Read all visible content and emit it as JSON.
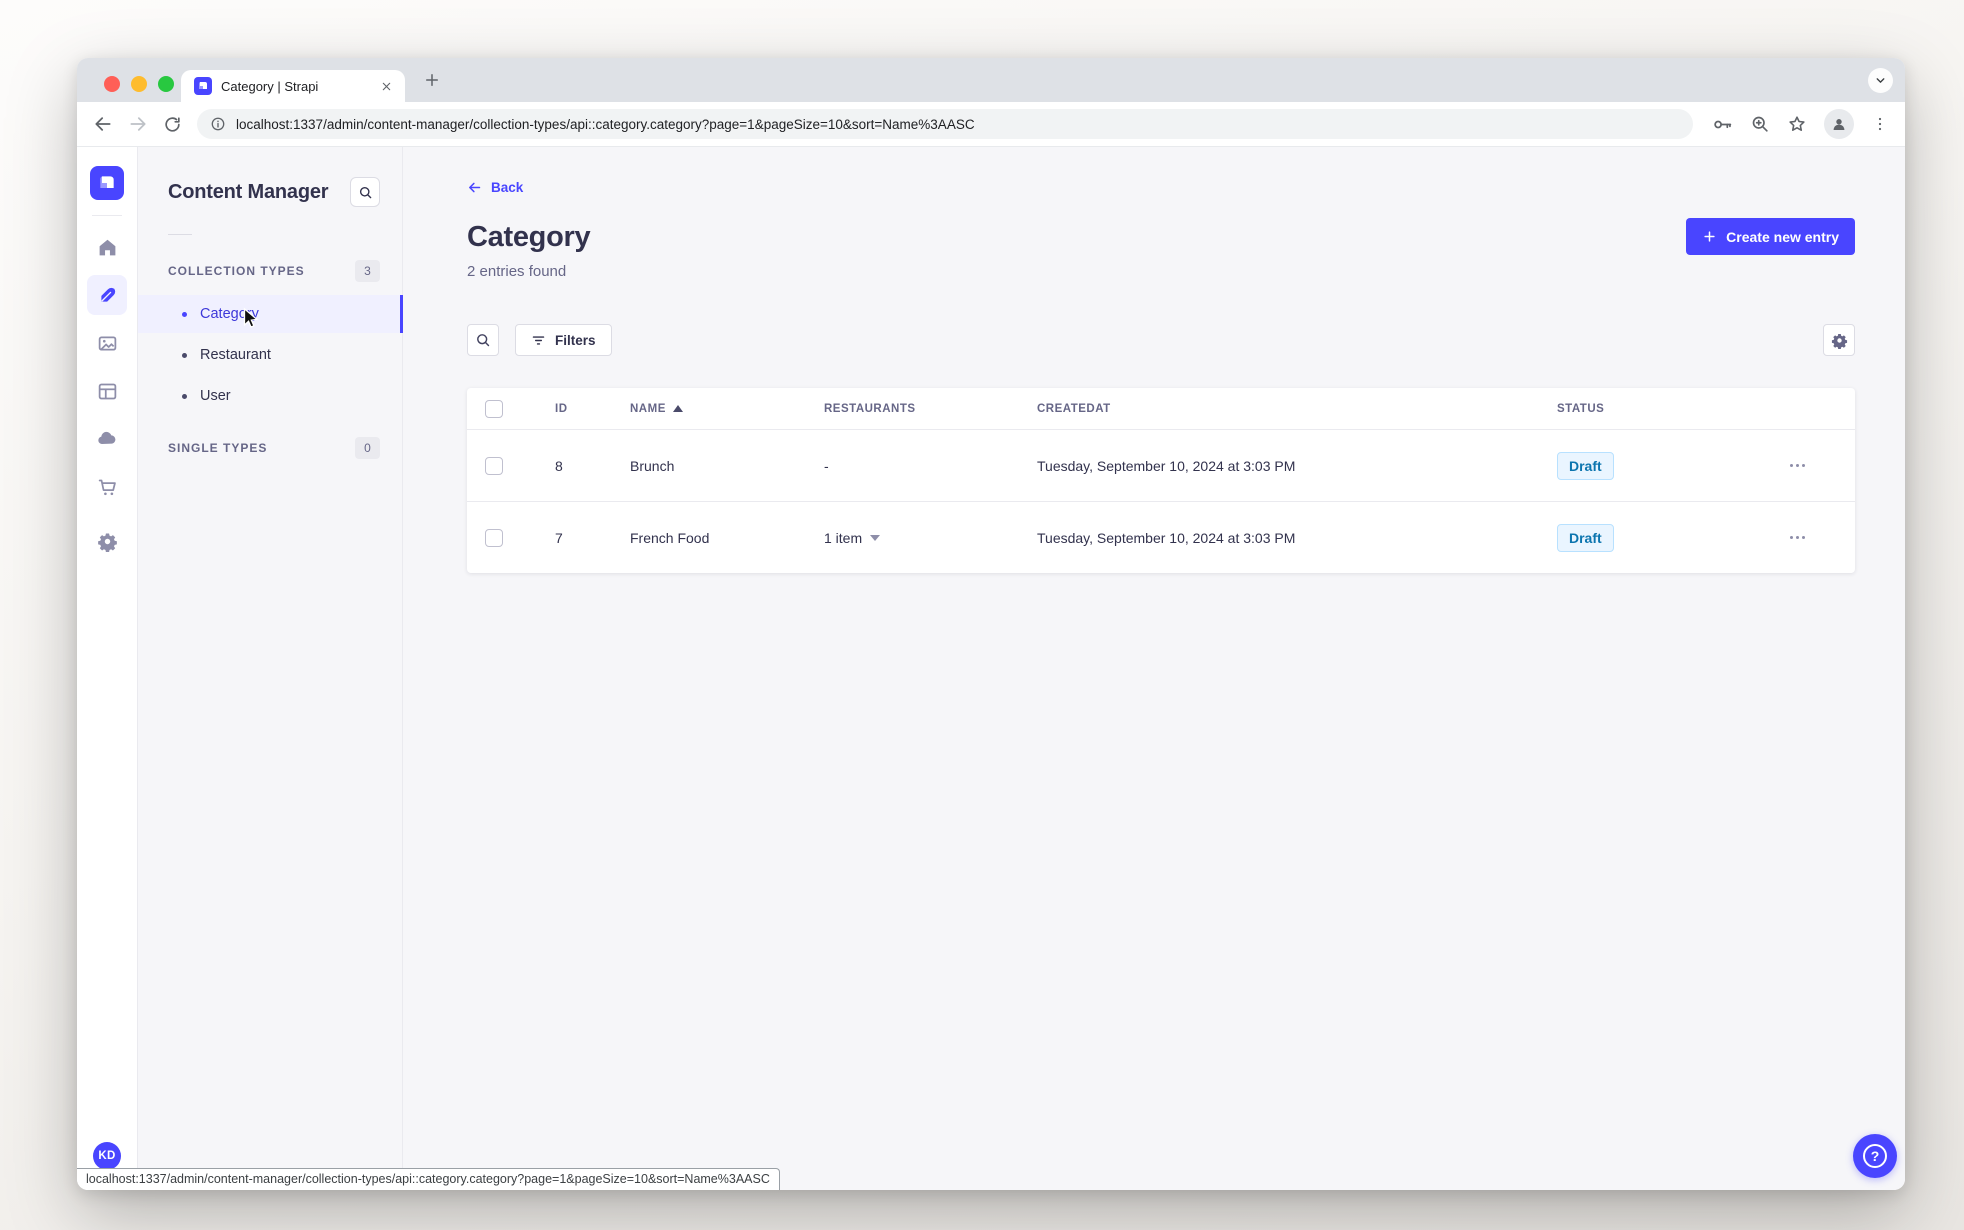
{
  "colors": {
    "primary": "#4945ff",
    "primary_bg": "#f0f0ff",
    "text_dark": "#32324d",
    "text_gray": "#666687",
    "border": "#eaeaef",
    "draft_bg": "#eaf5ff",
    "draft_border": "#b8e1ff",
    "draft_text": "#0c75af"
  },
  "browser": {
    "tab_title": "Category | Strapi",
    "url": "localhost:1337/admin/content-manager/collection-types/api::category.category?page=1&pageSize=10&sort=Name%3AASC",
    "status_url": "localhost:1337/admin/content-manager/collection-types/api::category.category?page=1&pageSize=10&sort=Name%3AASC"
  },
  "rail": {
    "avatar": "KD"
  },
  "subnav": {
    "title": "Content Manager",
    "collection_types": {
      "label": "COLLECTION TYPES",
      "count": "3"
    },
    "items": [
      {
        "label": "Category"
      },
      {
        "label": "Restaurant"
      },
      {
        "label": "User"
      }
    ],
    "single_types": {
      "label": "SINGLE TYPES",
      "count": "0"
    }
  },
  "page": {
    "back": "Back",
    "title": "Category",
    "subtitle": "2 entries found",
    "create_button": "Create new entry",
    "filters_button": "Filters"
  },
  "table": {
    "headers": {
      "id": "ID",
      "name": "NAME",
      "restaurants": "RESTAURANTS",
      "createdat": "CREATEDAT",
      "status": "STATUS"
    },
    "rows": [
      {
        "id": "8",
        "name": "Brunch",
        "restaurants": "-",
        "createdat": "Tuesday, September 10, 2024 at 3:03 PM",
        "status": "Draft"
      },
      {
        "id": "7",
        "name": "French Food",
        "restaurants": "1 item",
        "createdat": "Tuesday, September 10, 2024 at 3:03 PM",
        "status": "Draft"
      }
    ]
  },
  "icons": {
    "help_glyph": "?"
  }
}
